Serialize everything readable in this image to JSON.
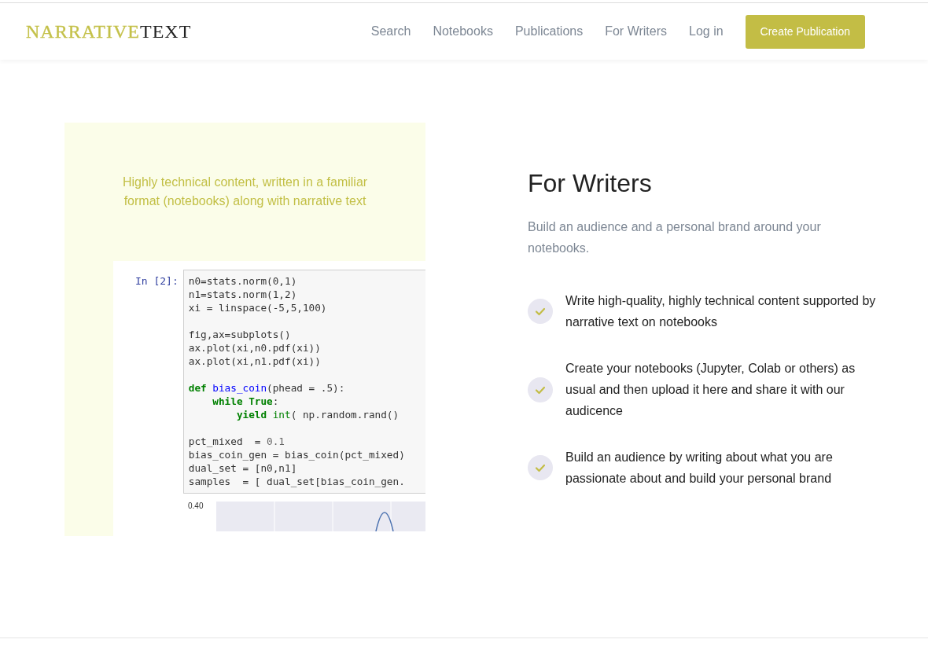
{
  "navbar": {
    "logo": {
      "part_1": "NARRATIVE",
      "part_2": "TEXT"
    },
    "links": [
      "Search",
      "Notebooks",
      "Publications",
      "For Writers",
      "Log in"
    ],
    "button": "Create Publication"
  },
  "showcase": {
    "caption": "Highly technical content, written in a familiar format (notebooks) along with narrative text",
    "prompt": "In [2]:",
    "code_lines": [
      {
        "kind": "code",
        "segments": [
          {
            "kind": "plain",
            "text": "n0=stats.norm(0,1)"
          }
        ]
      },
      {
        "kind": "code",
        "segments": [
          {
            "kind": "plain",
            "text": "n1=stats.norm(1,2)"
          }
        ]
      },
      {
        "kind": "code",
        "segments": [
          {
            "kind": "plain",
            "text": "xi = linspace(-5,5,100)"
          }
        ]
      },
      {
        "kind": "blank"
      },
      {
        "kind": "code",
        "segments": [
          {
            "kind": "plain",
            "text": "fig,ax=subplots()"
          }
        ]
      },
      {
        "kind": "code",
        "segments": [
          {
            "kind": "plain",
            "text": "ax.plot(xi,n0.pdf(xi))"
          }
        ]
      },
      {
        "kind": "code",
        "segments": [
          {
            "kind": "plain",
            "text": "ax.plot(xi,n1.pdf(xi))"
          }
        ]
      },
      {
        "kind": "blank"
      },
      {
        "kind": "code",
        "segments": [
          {
            "kind": "keyword",
            "text": "def"
          },
          {
            "kind": "function",
            "text": " bias_coin"
          },
          {
            "kind": "plain",
            "text": "(phead = .5):"
          }
        ]
      },
      {
        "kind": "code",
        "segments": [
          {
            "kind": "keyword",
            "text": "    while"
          },
          {
            "kind": "keyword",
            "text": " True"
          },
          {
            "kind": "plain",
            "text": ":"
          }
        ]
      },
      {
        "kind": "code",
        "segments": [
          {
            "kind": "keyword",
            "text": "        yield"
          },
          {
            "kind": "builtin",
            "text": " int"
          },
          {
            "kind": "plain",
            "text": "( np.random.rand()"
          }
        ]
      },
      {
        "kind": "blank"
      },
      {
        "kind": "code",
        "segments": [
          {
            "kind": "plain",
            "text": "pct_mixed  = "
          },
          {
            "kind": "number",
            "text": "0.1"
          }
        ]
      },
      {
        "kind": "code",
        "segments": [
          {
            "kind": "plain",
            "text": "bias_coin_gen = bias_coin(pct_mixed)"
          }
        ]
      },
      {
        "kind": "code",
        "segments": [
          {
            "kind": "plain",
            "text": "dual_set = [n0,n1]"
          }
        ]
      },
      {
        "kind": "code",
        "segments": [
          {
            "kind": "plain",
            "text": "samples  = [ dual_set[bias_coin_gen."
          }
        ]
      }
    ],
    "plot_tick": "0.40"
  },
  "section": {
    "title": "For Writers",
    "subtitle": "Build an audience and a personal brand around your notebooks.",
    "features": [
      "Write high-quality, highly technical content supported by narrative text on notebooks",
      "Create your notebooks (Jupyter, Colab or others) as usual and then upload it here and share it with our audicence",
      "Build an audience by writing about what you are passionate about and build your personal brand"
    ]
  }
}
